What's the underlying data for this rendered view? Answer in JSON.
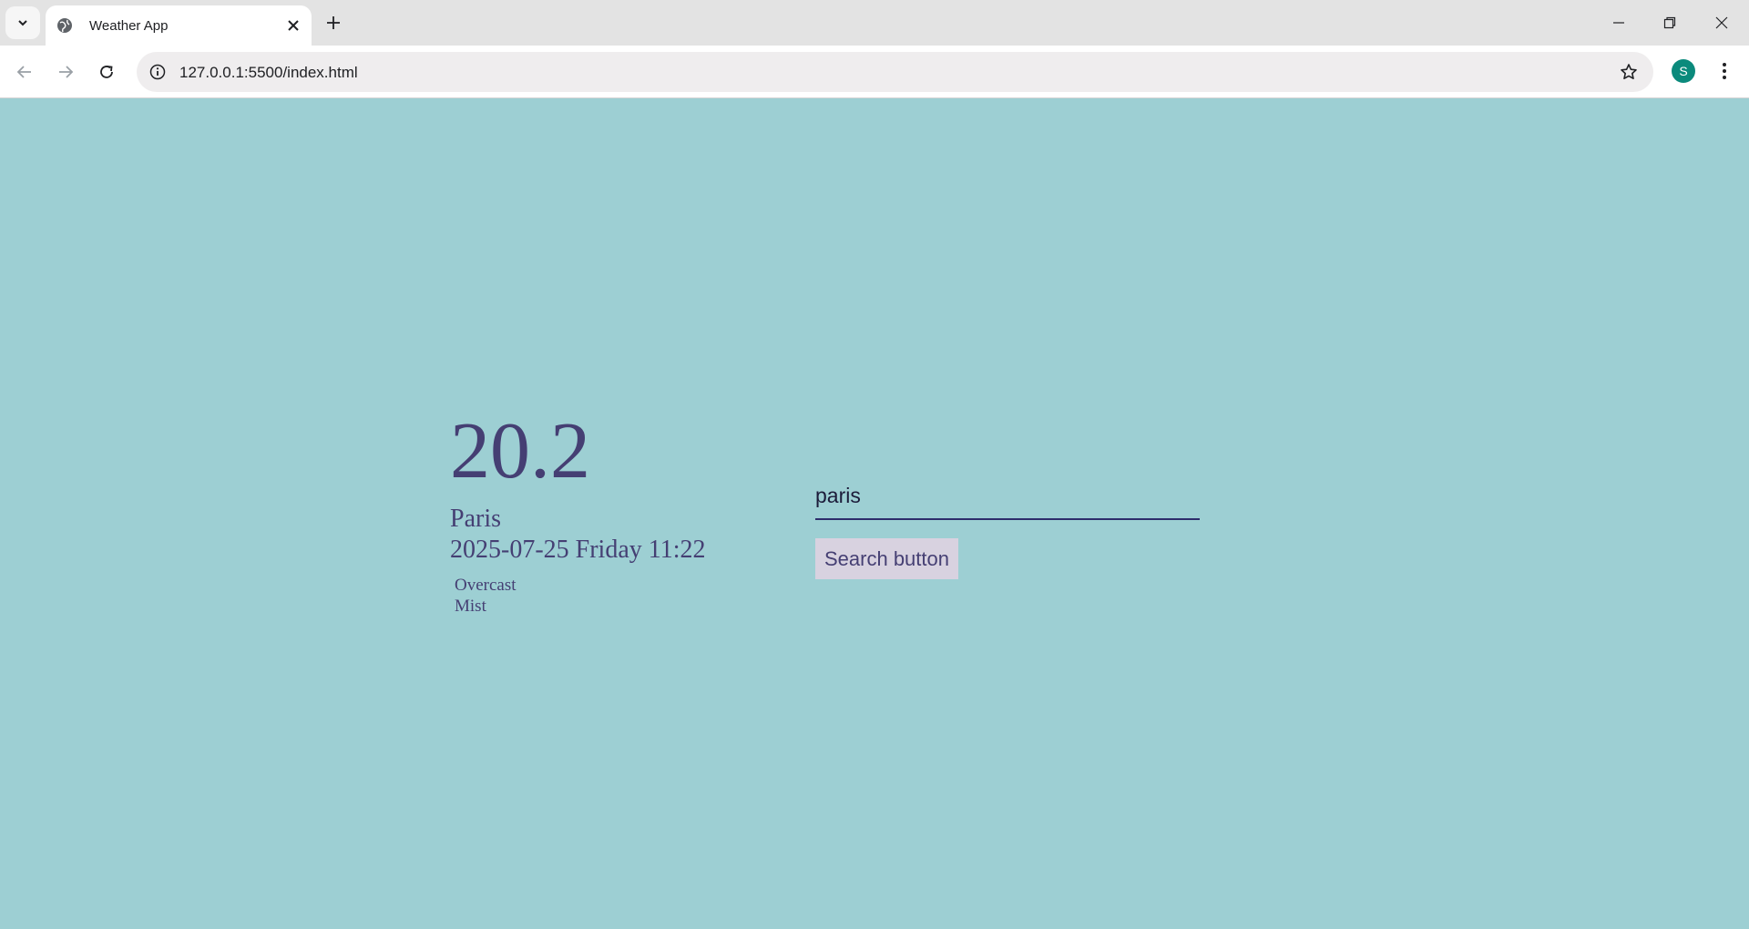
{
  "browser": {
    "tab_title": "Weather App",
    "url": "127.0.0.1:5500/index.html",
    "profile_initial": "S"
  },
  "weather": {
    "temperature": "20.2",
    "city": "Paris",
    "datetime": "2025-07-25 Friday 11:22",
    "conditions": [
      "Overcast",
      "Mist"
    ]
  },
  "search": {
    "value": "paris",
    "button_label": "Search button"
  },
  "colors": {
    "background": "#9dcfd3",
    "text": "#453f73",
    "button_bg": "#d8d2e0",
    "profile": "#0b8a7c"
  }
}
